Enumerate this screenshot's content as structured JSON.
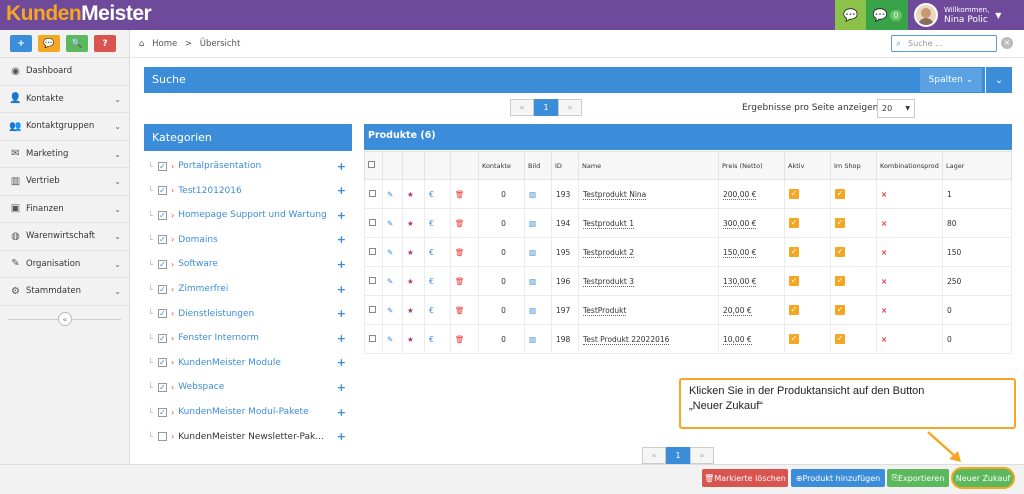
{
  "app": {
    "logo_a": "Kunden",
    "logo_b": "Meister"
  },
  "topbar": {
    "msg_count": "0",
    "welcome": "Willkommen,",
    "user_name": "Nina Polic"
  },
  "quick_actions": [
    "+",
    "💬",
    "🔍",
    "?"
  ],
  "sidebar": {
    "items": [
      {
        "label": "Dashboard",
        "icon": "dashboard-icon",
        "glyph": "◉",
        "chevron": false
      },
      {
        "label": "Kontakte",
        "icon": "user-icon",
        "glyph": "👤",
        "chevron": true
      },
      {
        "label": "Kontaktgruppen",
        "icon": "users-icon",
        "glyph": "👥",
        "chevron": true
      },
      {
        "label": "Marketing",
        "icon": "envelope-icon",
        "glyph": "✉",
        "chevron": true
      },
      {
        "label": "Vertrieb",
        "icon": "bar-chart-icon",
        "glyph": "▥",
        "chevron": true
      },
      {
        "label": "Finanzen",
        "icon": "money-icon",
        "glyph": "▣",
        "chevron": true
      },
      {
        "label": "Warenwirtschaft",
        "icon": "globe-icon",
        "glyph": "◍",
        "chevron": true
      },
      {
        "label": "Organisation",
        "icon": "edit-icon",
        "glyph": "✎",
        "chevron": true
      },
      {
        "label": "Stammdaten",
        "icon": "cogs-icon",
        "glyph": "⚙",
        "chevron": true
      }
    ]
  },
  "breadcrumb": {
    "home": "Home",
    "sep": ">",
    "current": "Übersicht"
  },
  "search": {
    "placeholder": "Suche ..."
  },
  "suche_panel": {
    "title": "Suche",
    "columns_button": "Spalten"
  },
  "pager": {
    "prev": "«",
    "page": "1",
    "next": "»"
  },
  "results_per_page": {
    "label": "Ergebnisse pro Seite anzeigen",
    "value": "20"
  },
  "categories": {
    "title": "Kategorien",
    "items": [
      {
        "label": "Portalpräsentation",
        "checked": true
      },
      {
        "label": "Test12012016",
        "checked": true
      },
      {
        "label": "Homepage Support und Wartung",
        "checked": true
      },
      {
        "label": "Domains",
        "checked": true
      },
      {
        "label": "Software",
        "checked": true
      },
      {
        "label": "Zimmerfrei",
        "checked": true
      },
      {
        "label": "Dienstleistungen",
        "checked": true
      },
      {
        "label": "Fenster Internorm",
        "checked": true
      },
      {
        "label": "KundenMeister Module",
        "checked": true
      },
      {
        "label": "Webspace",
        "checked": true
      },
      {
        "label": "KundenMeister Modul-Pakete",
        "checked": true
      },
      {
        "label": "KundenMeister Newsletter-Pak...",
        "checked": false
      }
    ]
  },
  "products": {
    "title": "Produkte (6)",
    "columns": [
      "Kontakte",
      "Bild",
      "ID",
      "Name",
      "Preis (Netto)",
      "Aktiv",
      "Im Shop",
      "Kombinationsprod",
      "Lager"
    ],
    "rows": [
      {
        "kontakte": "0",
        "id": "193",
        "name": "Testprodukt Nina",
        "preis": "200,00 €",
        "aktiv": true,
        "shop": true,
        "kombi": "×",
        "lager": "1"
      },
      {
        "kontakte": "0",
        "id": "194",
        "name": "Testprodukt 1",
        "preis": "300,00 €",
        "aktiv": true,
        "shop": true,
        "kombi": "×",
        "lager": "80"
      },
      {
        "kontakte": "0",
        "id": "195",
        "name": "Testprodukt 2",
        "preis": "150,00 €",
        "aktiv": true,
        "shop": true,
        "kombi": "×",
        "lager": "150"
      },
      {
        "kontakte": "0",
        "id": "196",
        "name": "Testprodukt 3",
        "preis": "130,00 €",
        "aktiv": true,
        "shop": true,
        "kombi": "×",
        "lager": "250"
      },
      {
        "kontakte": "0",
        "id": "197",
        "name": "TestProdukt",
        "preis": "20,00 €",
        "aktiv": true,
        "shop": true,
        "kombi": "×",
        "lager": "0"
      },
      {
        "kontakte": "0",
        "id": "198",
        "name": "Test Produkt 22022016",
        "preis": "10,00 €",
        "aktiv": true,
        "shop": true,
        "kombi": "×",
        "lager": "0"
      }
    ]
  },
  "callout": {
    "line1": "Klicken Sie in der Produktansicht auf den Button",
    "line2": "„Neuer Zukauf“"
  },
  "bottom_buttons": {
    "delete": "Markierte löschen",
    "add": "Produkt hinzufügen",
    "export": "Exportieren",
    "new_purchase": "Neuer Zukauf"
  },
  "colors": {
    "topbar": "#6f4a9a",
    "primary": "#3c8dd9",
    "accent": "#f5a623",
    "success": "#5cb85c",
    "danger": "#d9534f"
  }
}
